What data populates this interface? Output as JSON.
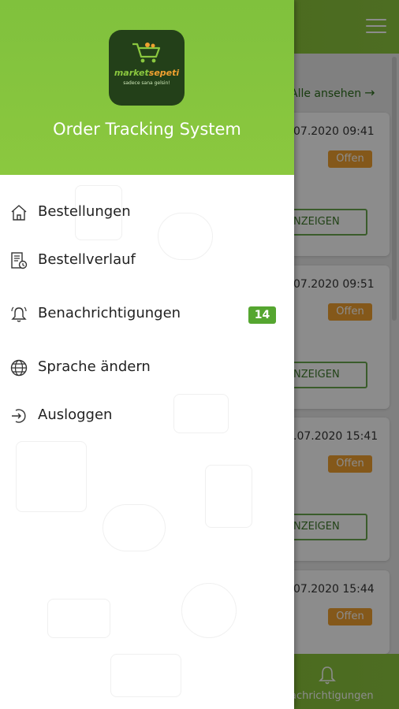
{
  "drawer": {
    "logo": {
      "brand_a": "market",
      "brand_b": "sepeti",
      "tagline": "sadece sana gelsin!"
    },
    "title": "Order Tracking System",
    "items": [
      {
        "label": "Bestellungen",
        "icon": "home-icon"
      },
      {
        "label": "Bestellverlauf",
        "icon": "history-icon"
      },
      {
        "label": "Benachrichtigungen",
        "icon": "bell-icon",
        "badge": "14"
      },
      {
        "label": "Sprache ändern",
        "icon": "globe-icon"
      },
      {
        "label": "Ausloggen",
        "icon": "logout-icon"
      }
    ]
  },
  "background": {
    "see_all": "Alle ansehen",
    "orders": [
      {
        "date": "07.2020 09:41",
        "status": "Offen",
        "button": "NZEIGEN"
      },
      {
        "date": "07.2020 09:51",
        "status": "Offen",
        "button": "NZEIGEN"
      },
      {
        "date": ".07.2020 15:41",
        "status": "Offen",
        "button": "NZEIGEN"
      },
      {
        "date": "07.2020 15:44",
        "status": "Offen"
      }
    ],
    "bottom_nav_label": "achrichtigungen"
  },
  "colors": {
    "brand_green": "#8bc83f",
    "status_orange": "#f0a030",
    "badge_green": "#55a630"
  }
}
